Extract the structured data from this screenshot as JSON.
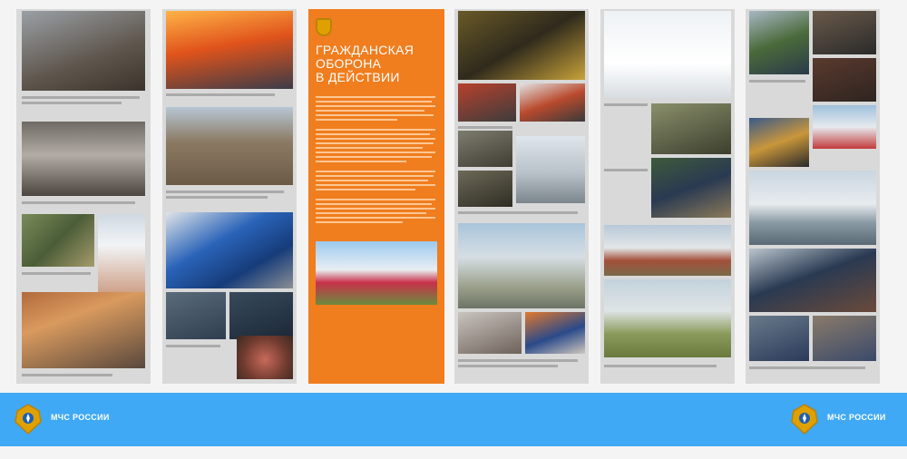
{
  "orange_panel": {
    "title_line1": "ГРАЖДАНСКАЯ",
    "title_line2": "ОБОРОНА",
    "title_line3": "В ДЕЙСТВИИ"
  },
  "footer": {
    "brand_left": "МЧС РОССИИ",
    "brand_right": "МЧС РОССИИ"
  },
  "colors": {
    "accent_orange": "#f07d1e",
    "footer_blue": "#3fa9f5",
    "panel_gray": "#d9d9d9"
  }
}
